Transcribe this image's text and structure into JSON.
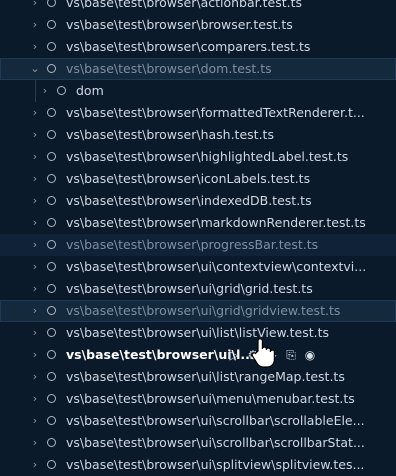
{
  "tree": {
    "rows": [
      {
        "label": "vs\\base\\test\\browser\\actionbar.test.ts",
        "chevron": "›",
        "state": "normal"
      },
      {
        "label": "vs\\base\\test\\browser\\browser.test.ts",
        "chevron": "›",
        "state": "normal"
      },
      {
        "label": "vs\\base\\test\\browser\\comparers.test.ts",
        "chevron": "›",
        "state": "normal"
      },
      {
        "label": "vs\\base\\test\\browser\\dom.test.ts",
        "chevron": "⌄",
        "state": "selected-dim"
      },
      {
        "label": "dom",
        "chevron": "›",
        "state": "child"
      },
      {
        "label": "vs\\base\\test\\browser\\formattedTextRenderer.t...",
        "chevron": "›",
        "state": "normal"
      },
      {
        "label": "vs\\base\\test\\browser\\hash.test.ts",
        "chevron": "›",
        "state": "normal"
      },
      {
        "label": "vs\\base\\test\\browser\\highlightedLabel.test.ts",
        "chevron": "›",
        "state": "normal"
      },
      {
        "label": "vs\\base\\test\\browser\\iconLabels.test.ts",
        "chevron": "›",
        "state": "normal"
      },
      {
        "label": "vs\\base\\test\\browser\\indexedDB.test.ts",
        "chevron": "›",
        "state": "normal"
      },
      {
        "label": "vs\\base\\test\\browser\\markdownRenderer.test.ts",
        "chevron": "›",
        "state": "normal"
      },
      {
        "label": "vs\\base\\test\\browser\\progressBar.test.ts",
        "chevron": "›",
        "state": "hover-dim"
      },
      {
        "label": "vs\\base\\test\\browser\\ui\\contextview\\contextvi...",
        "chevron": "›",
        "state": "normal"
      },
      {
        "label": "vs\\base\\test\\browser\\ui\\grid\\grid.test.ts",
        "chevron": "›",
        "state": "normal"
      },
      {
        "label": "vs\\base\\test\\browser\\ui\\grid\\gridview.test.ts",
        "chevron": "›",
        "state": "selected-dim"
      },
      {
        "label": "vs\\base\\test\\browser\\ui\\list\\listView.test.ts",
        "chevron": "›",
        "state": "normal"
      },
      {
        "label": "vs\\base\\test\\browser\\ui\\l...",
        "chevron": "›",
        "state": "bold-actions"
      },
      {
        "label": "vs\\base\\test\\browser\\ui\\list\\rangeMap.test.ts",
        "chevron": "›",
        "state": "normal"
      },
      {
        "label": "vs\\base\\test\\browser\\ui\\menu\\menubar.test.ts",
        "chevron": "›",
        "state": "normal"
      },
      {
        "label": "vs\\base\\test\\browser\\ui\\scrollbar\\scrollableEle...",
        "chevron": "›",
        "state": "normal"
      },
      {
        "label": "vs\\base\\test\\browser\\ui\\scrollbar\\scrollbarStat...",
        "chevron": "›",
        "state": "normal"
      },
      {
        "label": "vs\\base\\test\\browser\\ui\\splitview\\splitview.tes...",
        "chevron": "›",
        "state": "normal"
      }
    ],
    "actions": [
      {
        "icon": "run-test-icon",
        "glyph": "▷"
      },
      {
        "icon": "debug-test-icon",
        "glyph": "⚙"
      },
      {
        "icon": "run-with-coverage-icon",
        "glyph": "▷"
      },
      {
        "icon": "go-to-test-icon",
        "glyph": "⎘"
      },
      {
        "icon": "peek-output-icon",
        "glyph": "◉"
      }
    ]
  }
}
